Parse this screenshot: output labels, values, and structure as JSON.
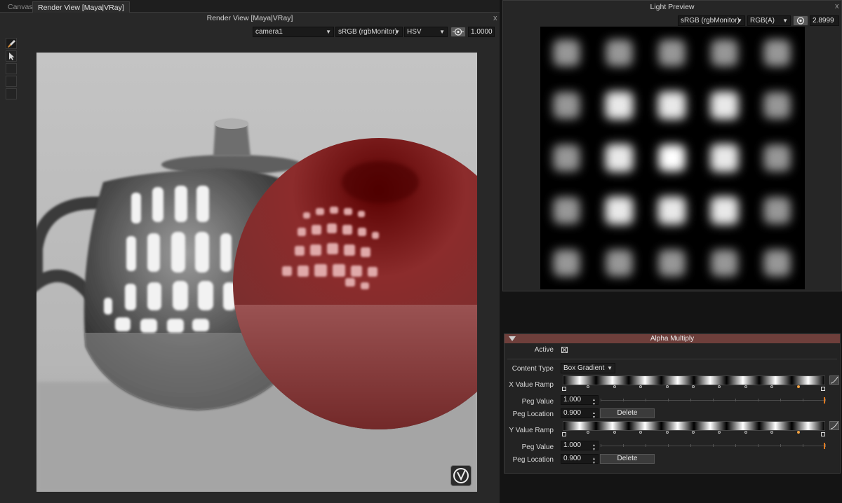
{
  "tabs": [
    {
      "label": "Canvas"
    },
    {
      "label": "Render View [Maya|VRay]"
    }
  ],
  "render_view": {
    "title": "Render View [Maya|VRay]",
    "camera": "camera1",
    "color_space": "sRGB (rgbMonitor)",
    "channel_mode": "HSV",
    "exposure": "1.0000",
    "close_glyph": "x"
  },
  "light_preview": {
    "title": "Light Preview",
    "color_space": "sRGB (rgbMonitor)",
    "channel_mode": "RGB(A)",
    "exposure": "2.8999",
    "close_glyph": "x"
  },
  "alpha_multiply": {
    "title": "Alpha Multiply",
    "active_label": "Active",
    "active": true,
    "content_type_label": "Content Type",
    "content_type": "Box Gradient",
    "x_ramp_label": "X Value Ramp",
    "y_ramp_label": "Y Value Ramp",
    "x_peg_value_label": "Peg Value",
    "x_peg_value": "1.000",
    "x_peg_location_label": "Peg Location",
    "x_peg_location": "0.900",
    "x_delete_label": "Delete",
    "y_peg_value_label": "Peg Value",
    "y_peg_value": "1.000",
    "y_peg_location_label": "Peg Location",
    "y_peg_location": "0.900",
    "y_delete_label": "Delete"
  },
  "icons": {
    "paint": "paint-brush-icon",
    "select": "arrow-cursor-icon",
    "exposure": "exposure-icon",
    "logo": "vray-logo-icon",
    "curve": "curve-editor-icon"
  },
  "colors": {
    "header_accent": "#6e3f3b",
    "peg_selected": "#e07a20"
  }
}
